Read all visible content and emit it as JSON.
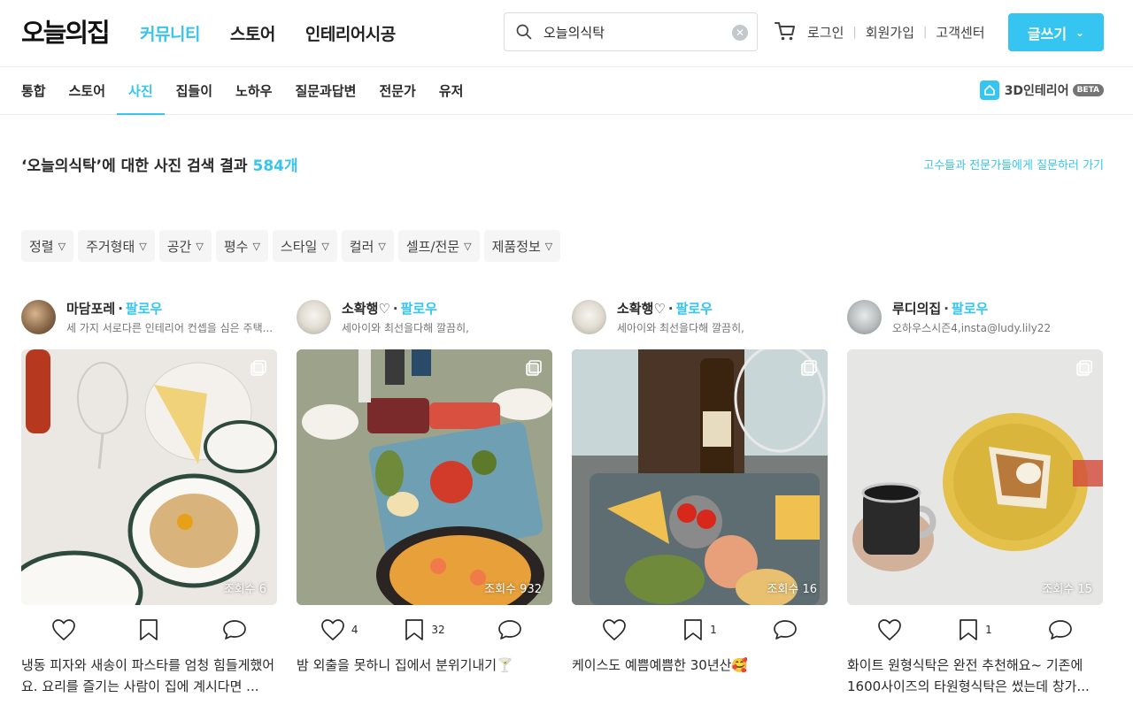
{
  "header": {
    "logo": "오늘의집",
    "nav": [
      "커뮤니티",
      "스토어",
      "인테리어시공"
    ],
    "search_value": "오늘의식탁",
    "user_links": [
      "로그인",
      "회원가입",
      "고객센터"
    ],
    "write_label": "글쓰기"
  },
  "subnav": {
    "tabs": [
      "통합",
      "스토어",
      "사진",
      "집들이",
      "노하우",
      "질문과답변",
      "전문가",
      "유저"
    ],
    "interior3d_label": "3D인테리어",
    "beta": "BETA"
  },
  "results": {
    "title_prefix": "‘오늘의식탁’에 대한 사진 검색 결과",
    "count": "584개",
    "ask_link": "고수들과 전문가들에게 질문하러 가기"
  },
  "filters": [
    "정렬",
    "주거형태",
    "공간",
    "평수",
    "스타일",
    "컬러",
    "셀프/전문",
    "제품정보"
  ],
  "follow_label": "팔로우",
  "cards": [
    {
      "author": "마담포레",
      "desc": "세 가지 서로다른 인테리어 컨셉을 심은 주택...",
      "views": "조회수 6",
      "likes": "",
      "scraps": "",
      "caption": "냉동 피자와 새송이 파스타를 엄청 힘들게했어요. 요리를 즐기는 사람이 집에 계시다면 ..."
    },
    {
      "author": "소확행♡",
      "desc": "세아이와 최선을다해 깔끔히,",
      "views": "조회수 932",
      "likes": "4",
      "scraps": "32",
      "caption": "밤 외출을 못하니 집에서 분위기내기🍸"
    },
    {
      "author": "소확행♡",
      "desc": "세아이와 최선을다해 깔끔히,",
      "views": "조회수 16",
      "likes": "",
      "scraps": "1",
      "caption": "케이스도 예쁨예쁨한 30년산🥰"
    },
    {
      "author": "루디의집",
      "desc": "오하우스시즌4,insta@ludy.lily22",
      "views": "조회수 15",
      "likes": "",
      "scraps": "1",
      "caption": "화이트 원형식탁은 완전 추천해요~ 기존에 1600사이즈의 타원형식탁은 썼는데 창가..."
    }
  ],
  "colors": {
    "accent": "#35c5f0",
    "text": "#292929",
    "muted": "#757575",
    "filter_bg": "#f5f5f5"
  }
}
